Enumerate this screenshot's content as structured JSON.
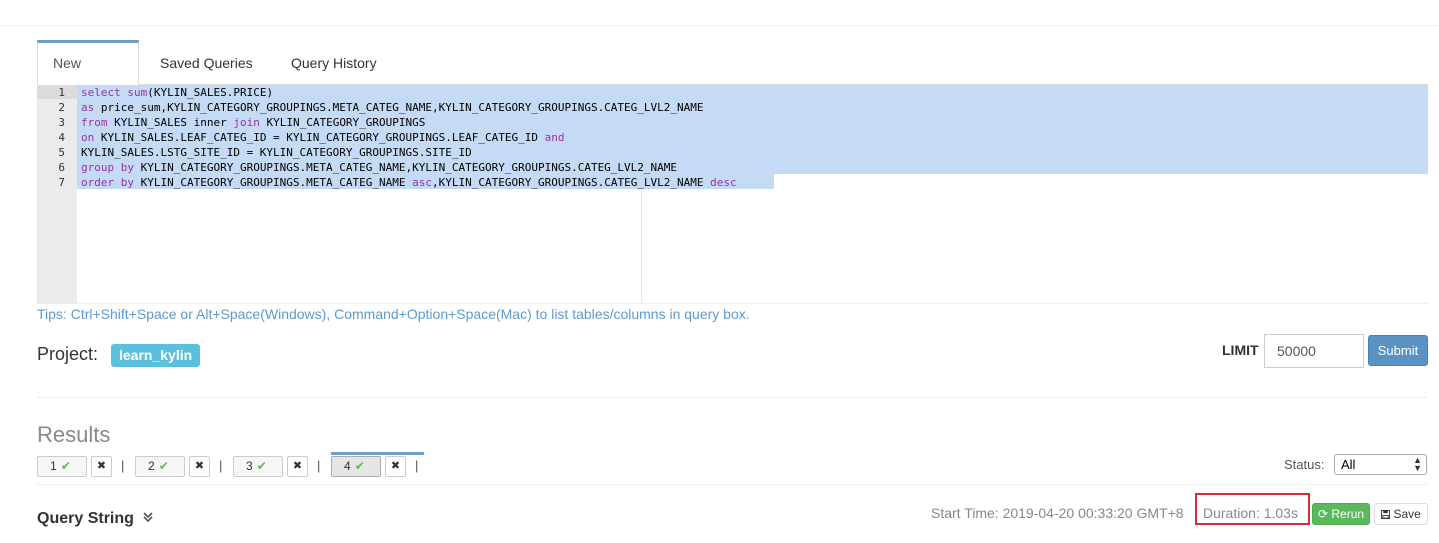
{
  "tabs": [
    {
      "label": "New Query"
    },
    {
      "label": "Saved Queries"
    },
    {
      "label": "Query History"
    }
  ],
  "editor": {
    "line_numbers": [
      "1",
      "2",
      "3",
      "4",
      "5",
      "6",
      "7"
    ],
    "lines": [
      [
        {
          "t": "select",
          "k": true
        },
        {
          "t": " "
        },
        {
          "t": "sum",
          "k": true
        },
        {
          "t": "(KYLIN_SALES.PRICE)"
        }
      ],
      [
        {
          "t": "as",
          "k": true
        },
        {
          "t": " price_sum,KYLIN_CATEGORY_GROUPINGS.META_CATEG_NAME,KYLIN_CATEGORY_GROUPINGS.CATEG_LVL2_NAME"
        }
      ],
      [
        {
          "t": "from",
          "k": true
        },
        {
          "t": " KYLIN_SALES "
        },
        {
          "t": "inner",
          "k": false
        },
        {
          "t": " "
        },
        {
          "t": "join",
          "k": true
        },
        {
          "t": " KYLIN_CATEGORY_GROUPINGS"
        }
      ],
      [
        {
          "t": "on",
          "k": true
        },
        {
          "t": " KYLIN_SALES.LEAF_CATEG_ID = KYLIN_CATEGORY_GROUPINGS.LEAF_CATEG_ID "
        },
        {
          "t": "and",
          "k": true
        }
      ],
      [
        {
          "t": "KYLIN_SALES.LSTG_SITE_ID = KYLIN_CATEGORY_GROUPINGS.SITE_ID"
        }
      ],
      [
        {
          "t": "group by",
          "k": true
        },
        {
          "t": " KYLIN_CATEGORY_GROUPINGS.META_CATEG_NAME,KYLIN_CATEGORY_GROUPINGS.CATEG_LVL2_NAME"
        }
      ],
      [
        {
          "t": "order by",
          "k": true
        },
        {
          "t": " KYLIN_CATEGORY_GROUPINGS.META_CATEG_NAME "
        },
        {
          "t": "asc",
          "k": true
        },
        {
          "t": ",KYLIN_CATEGORY_GROUPINGS.CATEG_LVL2_NAME "
        },
        {
          "t": "desc",
          "k": true
        }
      ]
    ]
  },
  "tips": "Tips: Ctrl+Shift+Space or Alt+Space(Windows), Command+Option+Space(Mac) to list tables/columns in query box.",
  "project": {
    "label": "Project:",
    "name": "learn_kylin"
  },
  "limit": {
    "label": "LIMIT",
    "value": "50000"
  },
  "submit_label": "Submit",
  "results": {
    "title": "Results",
    "chips": [
      {
        "label": "1",
        "check": "✔",
        "close": "✖"
      },
      {
        "label": "2",
        "check": "✔",
        "close": "✖"
      },
      {
        "label": "3",
        "check": "✔",
        "close": "✖"
      },
      {
        "label": "4",
        "check": "✔",
        "close": "✖"
      }
    ],
    "separator": "|",
    "status_label": "Status:",
    "status_value": "All"
  },
  "query_string": {
    "title": "Query String",
    "chevron": "⌄",
    "start_time": "Start Time: 2019-04-20 00:33:20 GMT+8",
    "duration": "Duration: 1.03s",
    "rerun_label": "Rerun",
    "save_label": "Save"
  }
}
